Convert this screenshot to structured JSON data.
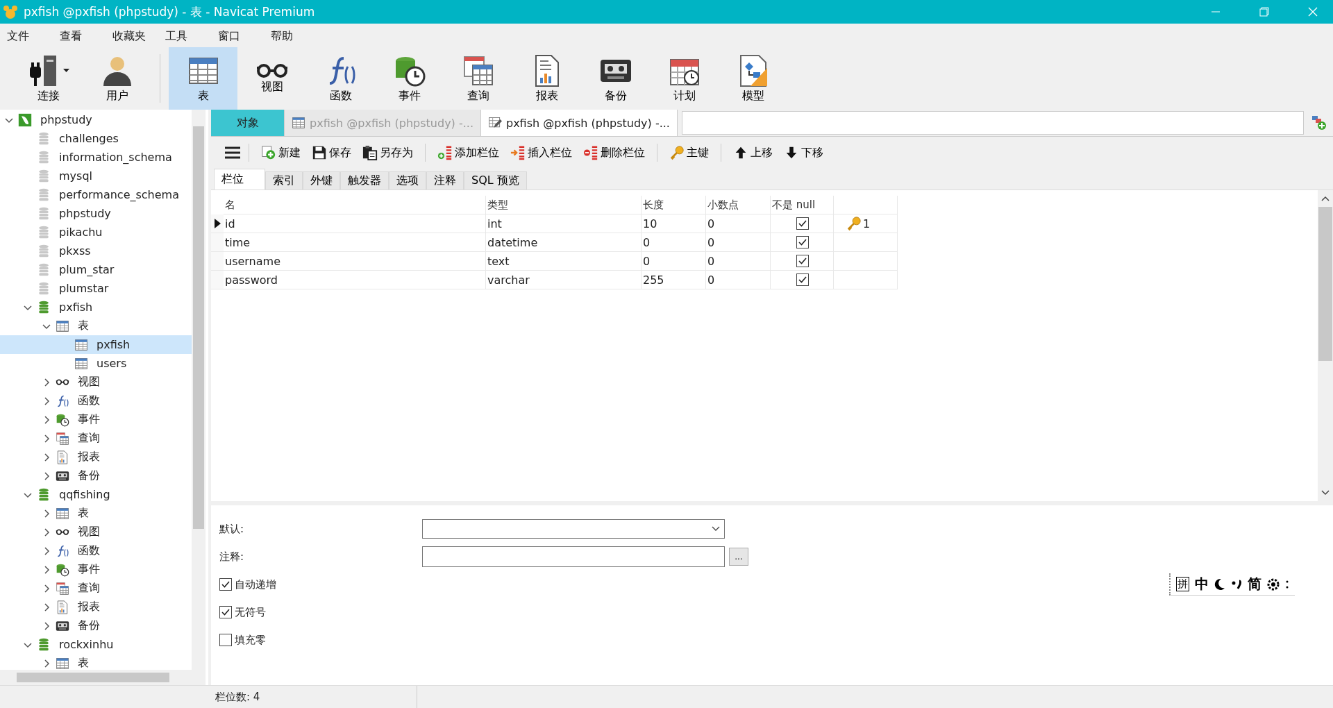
{
  "window": {
    "title": "pxfish @pxfish (phpstudy) - 表 - Navicat Premium"
  },
  "menu": [
    "文件",
    "查看",
    "收藏夹",
    "工具",
    "窗口",
    "帮助"
  ],
  "toolbar": [
    {
      "label": "连接",
      "kind": "connect",
      "selected": false,
      "dropdown": true
    },
    {
      "label": "用户",
      "kind": "user",
      "selected": false,
      "dropdown": false
    },
    {
      "label": "表",
      "kind": "table",
      "selected": true,
      "dropdown": false
    },
    {
      "label": "视图",
      "kind": "view",
      "selected": false,
      "dropdown": false
    },
    {
      "label": "函数",
      "kind": "function",
      "selected": false,
      "dropdown": false
    },
    {
      "label": "事件",
      "kind": "event",
      "selected": false,
      "dropdown": false
    },
    {
      "label": "查询",
      "kind": "query",
      "selected": false,
      "dropdown": false
    },
    {
      "label": "报表",
      "kind": "report",
      "selected": false,
      "dropdown": false
    },
    {
      "label": "备份",
      "kind": "backup",
      "selected": false,
      "dropdown": false
    },
    {
      "label": "计划",
      "kind": "schedule",
      "selected": false,
      "dropdown": false
    },
    {
      "label": "模型",
      "kind": "model",
      "selected": false,
      "dropdown": false
    }
  ],
  "sidebar": {
    "tree": [
      {
        "label": "phpstudy",
        "kind": "connection",
        "expanded": true,
        "selected": false,
        "children": [
          {
            "label": "challenges",
            "kind": "db-closed",
            "selected": false
          },
          {
            "label": "information_schema",
            "kind": "db-closed",
            "selected": false
          },
          {
            "label": "mysql",
            "kind": "db-closed",
            "selected": false
          },
          {
            "label": "performance_schema",
            "kind": "db-closed",
            "selected": false
          },
          {
            "label": "phpstudy",
            "kind": "db-closed",
            "selected": false
          },
          {
            "label": "pikachu",
            "kind": "db-closed",
            "selected": false
          },
          {
            "label": "pkxss",
            "kind": "db-closed",
            "selected": false
          },
          {
            "label": "plum_star",
            "kind": "db-closed",
            "selected": false
          },
          {
            "label": "plumstar",
            "kind": "db-closed",
            "selected": false
          },
          {
            "label": "pxfish",
            "kind": "db-open",
            "expanded": true,
            "selected": false,
            "children": [
              {
                "label": "表",
                "kind": "table",
                "expanded": true,
                "selected": false,
                "children": [
                  {
                    "label": "pxfish",
                    "kind": "table",
                    "selected": true
                  },
                  {
                    "label": "users",
                    "kind": "table",
                    "selected": false
                  }
                ]
              },
              {
                "label": "视图",
                "kind": "view",
                "expanded": false,
                "selected": false
              },
              {
                "label": "函数",
                "kind": "function",
                "expanded": false,
                "selected": false
              },
              {
                "label": "事件",
                "kind": "event",
                "expanded": false,
                "selected": false
              },
              {
                "label": "查询",
                "kind": "query",
                "expanded": false,
                "selected": false
              },
              {
                "label": "报表",
                "kind": "report",
                "expanded": false,
                "selected": false
              },
              {
                "label": "备份",
                "kind": "backup",
                "expanded": false,
                "selected": false
              }
            ]
          },
          {
            "label": "qqfishing",
            "kind": "db-open",
            "expanded": true,
            "selected": false,
            "children": [
              {
                "label": "表",
                "kind": "table",
                "expanded": false,
                "selected": false
              },
              {
                "label": "视图",
                "kind": "view",
                "expanded": false,
                "selected": false
              },
              {
                "label": "函数",
                "kind": "function",
                "expanded": false,
                "selected": false
              },
              {
                "label": "事件",
                "kind": "event",
                "expanded": false,
                "selected": false
              },
              {
                "label": "查询",
                "kind": "query",
                "expanded": false,
                "selected": false
              },
              {
                "label": "报表",
                "kind": "report",
                "expanded": false,
                "selected": false
              },
              {
                "label": "备份",
                "kind": "backup",
                "expanded": false,
                "selected": false
              }
            ]
          },
          {
            "label": "rockxinhu",
            "kind": "db-open",
            "expanded": true,
            "selected": false,
            "children": [
              {
                "label": "表",
                "kind": "table",
                "expanded": false,
                "selected": false
              }
            ]
          }
        ]
      }
    ]
  },
  "tabs": [
    {
      "label": "对象",
      "kind": "objects",
      "selected": false
    },
    {
      "label": "pxfish @pxfish (phpstudy) -...",
      "kind": "table",
      "selected": false
    },
    {
      "label": "pxfish @pxfish (phpstudy) -...",
      "kind": "design",
      "selected": true
    }
  ],
  "editor_toolbar": [
    {
      "label": "新建",
      "kind": "new"
    },
    {
      "label": "保存",
      "kind": "save"
    },
    {
      "label": "另存为",
      "kind": "saveas"
    },
    {
      "label": "添加栏位",
      "kind": "add"
    },
    {
      "label": "插入栏位",
      "kind": "insert"
    },
    {
      "label": "删除栏位",
      "kind": "delete"
    },
    {
      "label": "主键",
      "kind": "key"
    },
    {
      "label": "上移",
      "kind": "up"
    },
    {
      "label": "下移",
      "kind": "down"
    }
  ],
  "subtabs": [
    {
      "label": "栏位",
      "selected": true
    },
    {
      "label": "索引",
      "selected": false
    },
    {
      "label": "外键",
      "selected": false
    },
    {
      "label": "触发器",
      "selected": false
    },
    {
      "label": "选项",
      "selected": false
    },
    {
      "label": "注释",
      "selected": false
    },
    {
      "label": "SQL 预览",
      "selected": false
    }
  ],
  "table": {
    "columns": [
      "名",
      "类型",
      "长度",
      "小数点",
      "不是 null"
    ],
    "rows": [
      {
        "name": "id",
        "type": "int",
        "length": "10",
        "decimals": "0",
        "not_null": true,
        "key": "1",
        "selected": true
      },
      {
        "name": "time",
        "type": "datetime",
        "length": "0",
        "decimals": "0",
        "not_null": true,
        "selected": false
      },
      {
        "name": "username",
        "type": "text",
        "length": "0",
        "decimals": "0",
        "not_null": true,
        "selected": false
      },
      {
        "name": "password",
        "type": "varchar",
        "length": "255",
        "decimals": "0",
        "not_null": true,
        "selected": false
      }
    ]
  },
  "properties": {
    "default_label": "默认:",
    "comment_label": "注释:",
    "more_button": "...",
    "options": [
      {
        "label": "自动递增",
        "checked": true
      },
      {
        "label": "无符号",
        "checked": true
      },
      {
        "label": "填充零",
        "checked": false
      }
    ]
  },
  "ime_bar": [
    "拼",
    "中",
    "简"
  ],
  "status_bar": "栏位数: 4"
}
